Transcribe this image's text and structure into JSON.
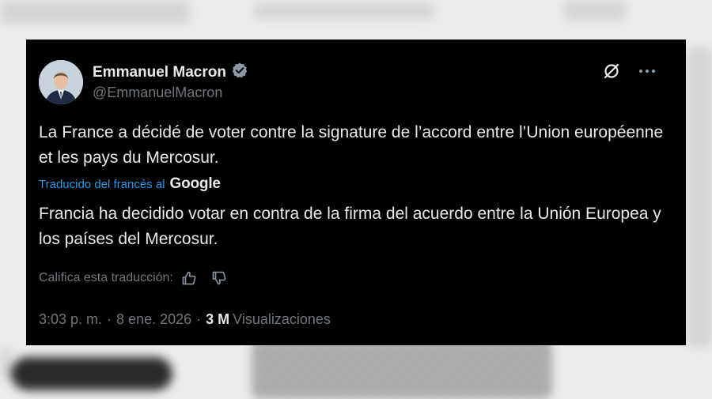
{
  "tweet": {
    "author_name": "Emmanuel Macron",
    "verified": true,
    "handle": "@EmmanuelMacron",
    "original_text": "La France a décidé de voter contre la signature de l’accord entre l’Union européenne et les pays du Mercosur.",
    "translation_label": "Traducido del francés al",
    "translation_provider": "Google",
    "translated_text": "Francia ha decidido votar en contra de la firma del acuerdo entre la Unión Europea y los países del Mercosur.",
    "rate_label": "Califica esta traducción:",
    "time": "3:03 p. m.",
    "separator": "·",
    "date": "8 ene. 2026",
    "views_count": "3 M",
    "views_label": "Visualizaciones"
  },
  "icons": {
    "verified": "verified-badge-icon",
    "grok": "grok-icon",
    "more": "more-options-icon",
    "thumbs_up": "thumbs-up-icon",
    "thumbs_down": "thumbs-down-icon"
  },
  "colors": {
    "card_background": "#000000",
    "text_primary": "#e7e9ea",
    "text_secondary": "#71767b",
    "link_blue": "#1d9bf0",
    "verified_badge": "#8b98a5"
  }
}
